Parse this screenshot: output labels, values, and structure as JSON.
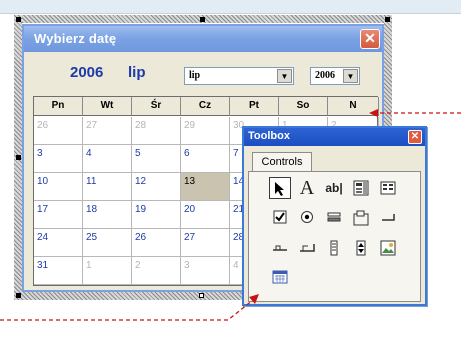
{
  "form": {
    "title": "Wybierz datę",
    "year_label": "2006",
    "month_label": "lip",
    "month_combo_value": "lip",
    "year_combo_value": "2006",
    "close_glyph": "✕"
  },
  "calendar": {
    "weekdays": [
      "Pn",
      "Wt",
      "Śr",
      "Cz",
      "Pt",
      "So",
      "N"
    ],
    "rows": [
      [
        {
          "d": "26",
          "k": "out"
        },
        {
          "d": "27",
          "k": "out"
        },
        {
          "d": "28",
          "k": "out"
        },
        {
          "d": "29",
          "k": "out"
        },
        {
          "d": "30",
          "k": "out"
        },
        {
          "d": "1",
          "k": "out"
        },
        {
          "d": "2",
          "k": "out"
        }
      ],
      [
        {
          "d": "3",
          "k": "cur"
        },
        {
          "d": "4",
          "k": "cur"
        },
        {
          "d": "5",
          "k": "cur"
        },
        {
          "d": "6",
          "k": "cur"
        },
        {
          "d": "7",
          "k": "cur"
        },
        {
          "d": "",
          "k": "cur"
        },
        {
          "d": "",
          "k": "cur"
        }
      ],
      [
        {
          "d": "10",
          "k": "cur"
        },
        {
          "d": "11",
          "k": "cur"
        },
        {
          "d": "12",
          "k": "cur"
        },
        {
          "d": "13",
          "k": "today"
        },
        {
          "d": "14",
          "k": "cur"
        },
        {
          "d": "",
          "k": "cur"
        },
        {
          "d": "",
          "k": "cur"
        }
      ],
      [
        {
          "d": "17",
          "k": "cur"
        },
        {
          "d": "18",
          "k": "cur"
        },
        {
          "d": "19",
          "k": "cur"
        },
        {
          "d": "20",
          "k": "cur"
        },
        {
          "d": "21",
          "k": "cur"
        },
        {
          "d": "",
          "k": "cur"
        },
        {
          "d": "",
          "k": "cur"
        }
      ],
      [
        {
          "d": "24",
          "k": "cur"
        },
        {
          "d": "25",
          "k": "cur"
        },
        {
          "d": "26",
          "k": "cur"
        },
        {
          "d": "27",
          "k": "cur"
        },
        {
          "d": "28",
          "k": "cur"
        },
        {
          "d": "",
          "k": "cur"
        },
        {
          "d": "",
          "k": "cur"
        }
      ],
      [
        {
          "d": "31",
          "k": "cur"
        },
        {
          "d": "1",
          "k": "out"
        },
        {
          "d": "2",
          "k": "out"
        },
        {
          "d": "3",
          "k": "out"
        },
        {
          "d": "4",
          "k": "out"
        },
        {
          "d": "",
          "k": "out"
        },
        {
          "d": "",
          "k": "out"
        }
      ]
    ]
  },
  "toolbox": {
    "title": "Toolbox",
    "tab_label": "Controls",
    "close_glyph": "✕",
    "tools": [
      "pointer-icon",
      "label-icon",
      "textbox-icon",
      "combobox-icon",
      "listbox-icon",
      "checkbox-icon",
      "optionbutton-icon",
      "togglebutton-icon",
      "frame-icon",
      "commandbutton-icon",
      "tabstrip-icon",
      "multipage-icon",
      "scrollbar-icon",
      "spinbutton-icon",
      "image-icon",
      "calendar-control-icon"
    ],
    "label_glyph": "A",
    "textbox_glyph": "ab|"
  },
  "colors": {
    "form_title": "#7ca3e4",
    "toolbox_title": "#1c4fc2",
    "accent_blue": "#1c3aa8",
    "callout_red": "#cc1111",
    "today_cell": "#c9c3b0"
  }
}
